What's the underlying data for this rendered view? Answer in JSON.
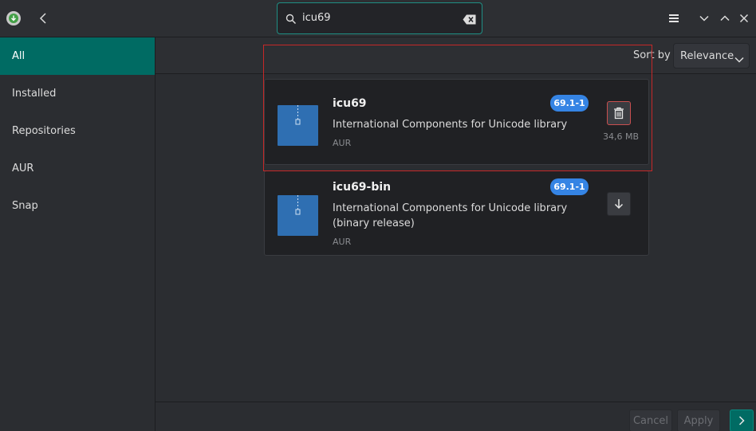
{
  "header": {
    "search": {
      "value": "icu69"
    }
  },
  "sidebar": {
    "items": [
      {
        "label": "All",
        "active": true
      },
      {
        "label": "Installed"
      },
      {
        "label": "Repositories"
      },
      {
        "label": "AUR"
      },
      {
        "label": "Snap"
      }
    ]
  },
  "sort": {
    "label": "Sort by",
    "selected": "Relevance"
  },
  "packages": [
    {
      "name": "icu69",
      "version": "69.1-1",
      "description": "International Components for Unicode library",
      "repo": "AUR",
      "size": "34,6 MB",
      "action_icon": "trash-icon",
      "installed": true
    },
    {
      "name": "icu69-bin",
      "version": "69.1-1",
      "description": "International Components for Unicode library (binary release)",
      "repo": "AUR",
      "action_icon": "download-arrow-icon",
      "installed": false
    }
  ],
  "footer": {
    "cancel_label": "Cancel",
    "apply_label": "Apply"
  },
  "colors": {
    "accent": "#006b63",
    "badge": "#3584e4",
    "highlight": "#c62828",
    "package_icon": "#2f6fb2"
  }
}
